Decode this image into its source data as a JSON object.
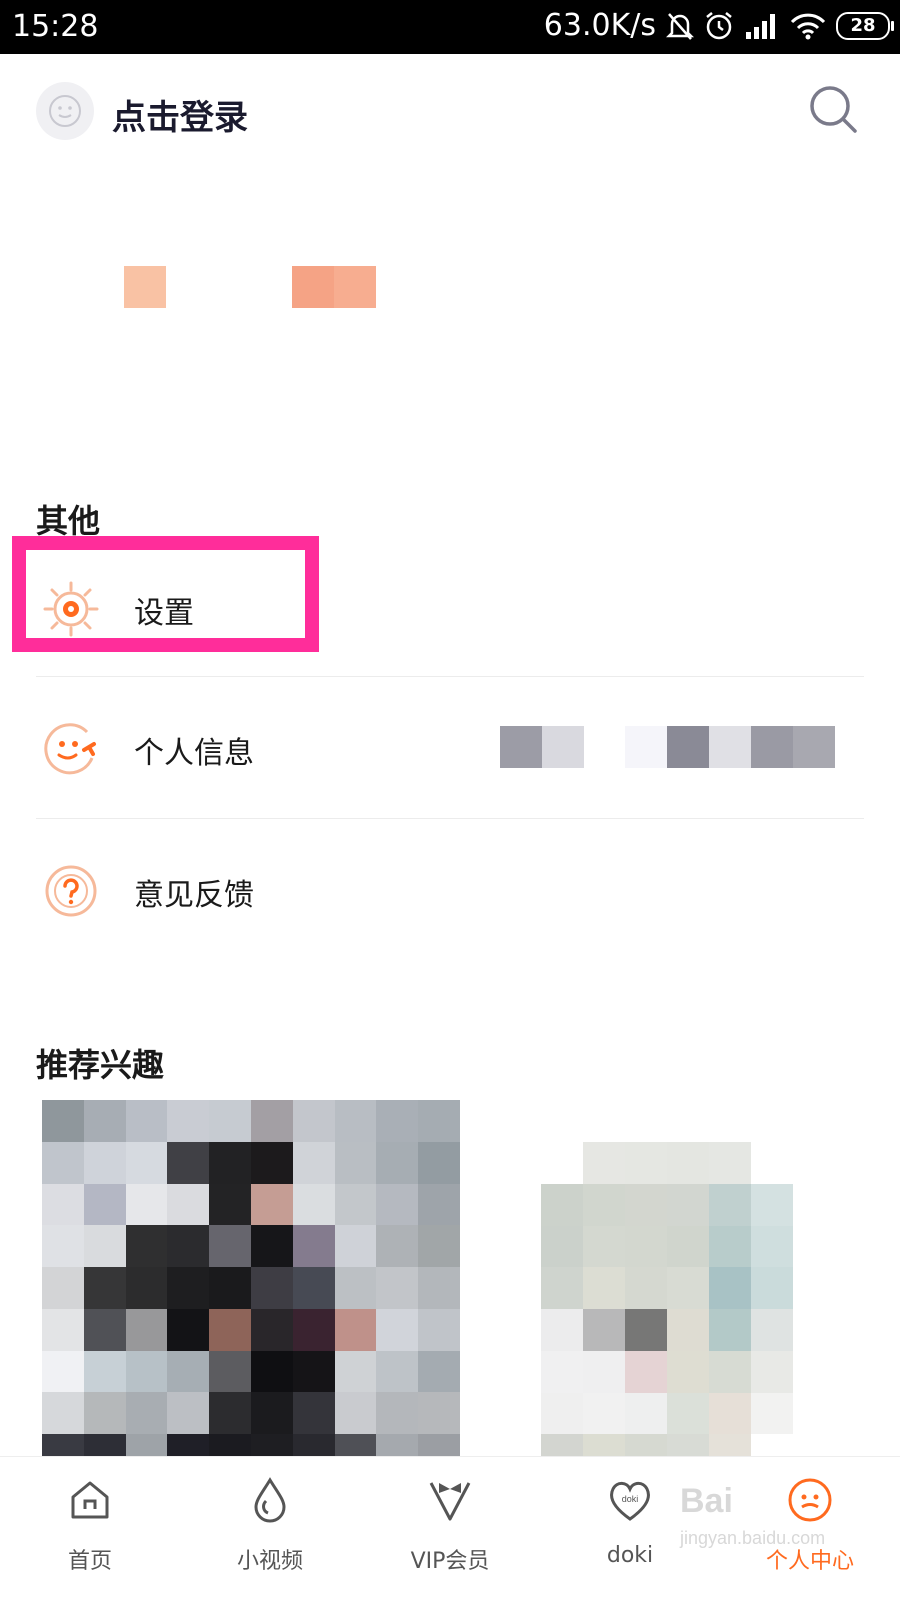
{
  "status_bar": {
    "time": "15:28",
    "network_speed": "63.0K/s",
    "battery": "28",
    "icons": [
      "mute-icon",
      "alarm-icon",
      "signal-icon",
      "wifi-icon",
      "battery-icon"
    ]
  },
  "header": {
    "login_text": "点击登录",
    "avatar_icon": "smiley-avatar-icon",
    "search_icon": "search-icon"
  },
  "other_section": {
    "title": "其他",
    "items": [
      {
        "label": "设置",
        "icon": "gear-icon"
      },
      {
        "label": "个人信息",
        "icon": "face-wrench-icon"
      },
      {
        "label": "意见反馈",
        "icon": "question-icon"
      }
    ]
  },
  "recommend_section": {
    "title": "推荐兴趣"
  },
  "tab_bar": {
    "tabs": [
      {
        "label": "首页",
        "icon": "home-icon",
        "active": false
      },
      {
        "label": "小视频",
        "icon": "droplet-icon",
        "active": false
      },
      {
        "label": "VIP会员",
        "icon": "vip-bowtie-icon",
        "active": false
      },
      {
        "label": "doki",
        "icon": "doki-heart-icon",
        "active": false
      },
      {
        "label": "个人中心",
        "icon": "profile-face-icon",
        "active": true
      }
    ]
  },
  "watermark": {
    "line1": "Bai",
    "line2": "jingyan.baidu.com"
  },
  "colors": {
    "accent": "#ff6a1f",
    "highlight": "#ff2d9a",
    "status_bar": "#000000"
  }
}
